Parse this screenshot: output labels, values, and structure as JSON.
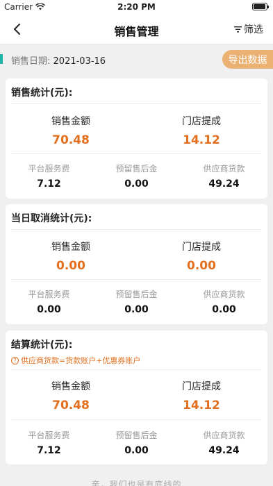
{
  "status_bar": {
    "carrier": "Carrier",
    "time": "2:20 PM"
  },
  "nav": {
    "title": "销售管理",
    "filter_label": "筛选"
  },
  "date_bar": {
    "label": "销售日期:",
    "value": "2021-03-16",
    "export_label": "导出数据"
  },
  "sales_stats": {
    "title": "销售统计(元):",
    "sales_amount_label": "销售金额",
    "sales_amount": "70.48",
    "store_commission_label": "门店提成",
    "store_commission": "14.12",
    "platform_fee_label": "平台服务费",
    "platform_fee": "7.12",
    "reserved_aftersale_label": "预留售后金",
    "reserved_aftersale": "0.00",
    "supplier_payment_label": "供应商货款",
    "supplier_payment": "49.24"
  },
  "cancel_stats": {
    "title": "当日取消统计(元):",
    "sales_amount_label": "销售金额",
    "sales_amount": "0.00",
    "store_commission_label": "门店提成",
    "store_commission": "0.00",
    "platform_fee_label": "平台服务费",
    "platform_fee": "0.00",
    "reserved_aftersale_label": "预留售后金",
    "reserved_aftersale": "0.00",
    "supplier_payment_label": "供应商货款",
    "supplier_payment": "0.00"
  },
  "settlement_stats": {
    "title": "结算统计(元):",
    "note": "供应商货款=货款账户+优惠券账户",
    "sales_amount_label": "销售金额",
    "sales_amount": "70.48",
    "store_commission_label": "门店提成",
    "store_commission": "14.12",
    "platform_fee_label": "平台服务费",
    "platform_fee": "7.12",
    "reserved_aftersale_label": "预留售后金",
    "reserved_aftersale": "0.00",
    "supplier_payment_label": "供应商货款",
    "supplier_payment": "49.24"
  },
  "footer": {
    "text": "亲，我们也是有底线的"
  },
  "colors": {
    "accent": "#e2701f",
    "export_button": "#eab173",
    "date_marker": "#1fb5a8"
  },
  "icons": {
    "back": "chevron-left-icon",
    "filter": "filter-icon",
    "note": "question-circle-icon"
  }
}
